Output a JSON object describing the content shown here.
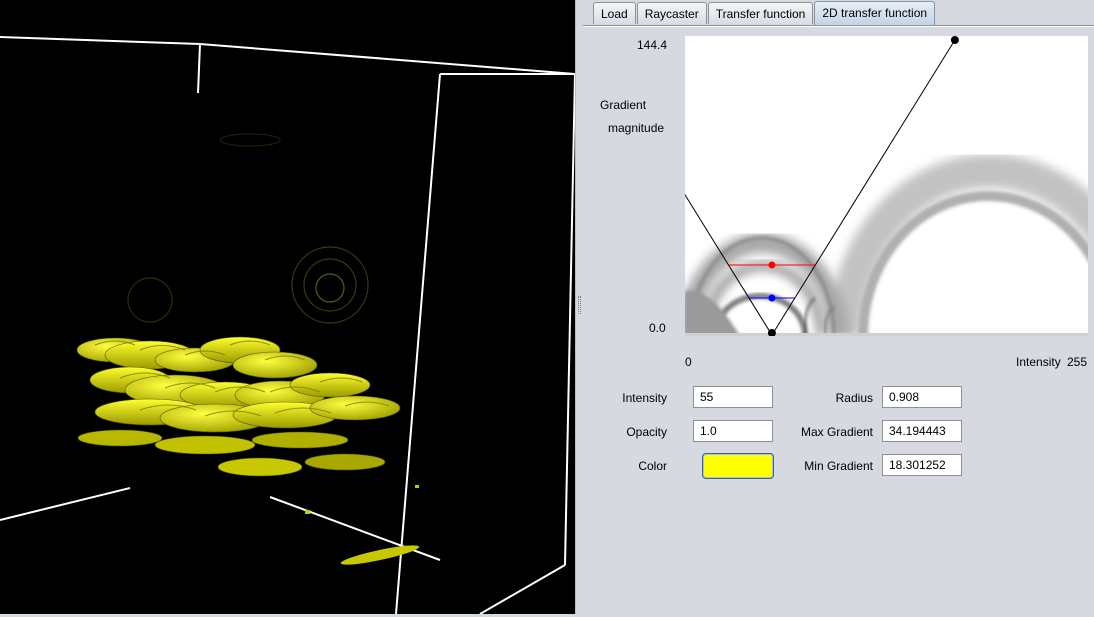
{
  "tabs": [
    {
      "label": "Load"
    },
    {
      "label": "Raycaster"
    },
    {
      "label": "Transfer function"
    },
    {
      "label": "2D transfer function"
    }
  ],
  "active_tab": 3,
  "histogram": {
    "y_max_label": "144.4",
    "y_min_label": "0.0",
    "y_axis_title_line1": "Gradient",
    "y_axis_title_line2": "magnitude",
    "x_min_label": "0",
    "x_axis_title": "Intensity",
    "x_max_label": "255"
  },
  "widget": {
    "intensity": 55,
    "radius": 0.908,
    "max_gradient": 34.194443,
    "min_gradient": 18.301252,
    "gradient_max": 144.4,
    "intensity_max": 255,
    "max_marker_color": "#ff0000",
    "min_marker_color": "#0000ff"
  },
  "form": {
    "intensity_label": "Intensity",
    "intensity_value": "55",
    "opacity_label": "Opacity",
    "opacity_value": "1.0",
    "color_label": "Color",
    "color_value": "#ffff00",
    "radius_label": "Radius",
    "radius_value": "0.908",
    "max_gradient_label": "Max Gradient",
    "max_gradient_value": "34.194443",
    "min_gradient_label": "Min Gradient",
    "min_gradient_value": "18.301252"
  },
  "render": {
    "background": "#000000",
    "bbox_color": "#ffffff",
    "volume_color": "#ffff00"
  }
}
